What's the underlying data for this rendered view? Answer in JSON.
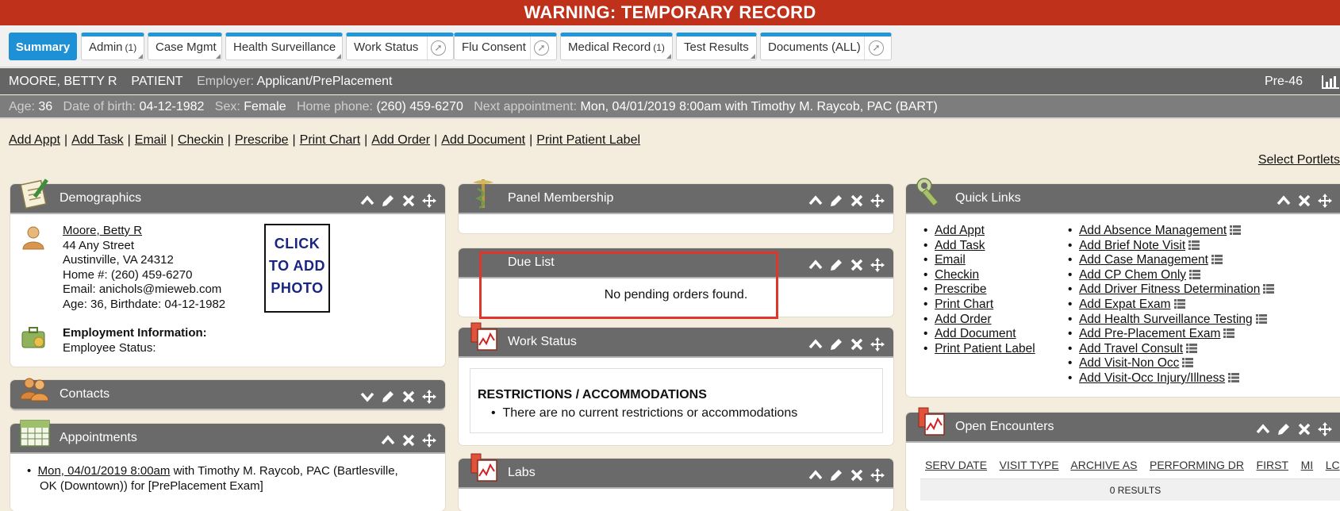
{
  "warning": "WARNING: TEMPORARY RECORD",
  "tabs": [
    {
      "label": "Summary",
      "count": "",
      "active": true
    },
    {
      "label": "Admin",
      "count": "(1)"
    },
    {
      "label": "Case Mgmt",
      "count": ""
    },
    {
      "label": "Health Surveillance",
      "count": ""
    },
    {
      "label": "Work Status",
      "count": ""
    },
    {
      "label": "Flu Consent",
      "count": ""
    },
    {
      "label": "Medical Record",
      "count": "(1)"
    },
    {
      "label": "Test Results",
      "count": ""
    },
    {
      "label": "Documents (ALL)",
      "count": ""
    }
  ],
  "patient": {
    "name": "MOORE, BETTY R",
    "type": "PATIENT",
    "employer_label": "Employer:",
    "employer": "Applicant/PrePlacement",
    "id": "Pre-46",
    "age_label": "Age:",
    "age": "36",
    "dob_label": "Date of birth:",
    "dob": "04-12-1982",
    "sex_label": "Sex:",
    "sex": "Female",
    "phone_label": "Home phone:",
    "phone": "(260) 459-6270",
    "next_label": "Next appointment:",
    "next_appt": "Mon, 04/01/2019 8:00am with Timothy M. Raycob, PAC (BART)"
  },
  "actions": [
    "Add Appt",
    "Add Task",
    "Email",
    "Checkin",
    "Prescribe",
    "Print Chart",
    "Add Order",
    "Add Document",
    "Print Patient Label"
  ],
  "actions_sep": "|",
  "select_portlets": "Select Portlets",
  "demographics": {
    "title": "Demographics",
    "name_link": "Moore, Betty R",
    "address1": "44 Any Street",
    "address2": "Austinville, VA 24312",
    "home": "Home #: (260) 459-6270",
    "email": "Email: anichols@mieweb.com",
    "age_line": "Age: 36, Birthdate: 04-12-1982",
    "photo": [
      "CLICK",
      "TO ADD",
      "PHOTO"
    ],
    "employment_heading": "Employment Information:",
    "employee_status": "Employee Status:"
  },
  "contacts": {
    "title": "Contacts"
  },
  "appointments": {
    "title": "Appointments",
    "bullet": "•",
    "appt_link": "Mon, 04/01/2019 8:00am",
    "appt_text1": " with Timothy M. Raycob, PAC (Bartlesville,",
    "appt_text2": "OK (Downtown)) for [PrePlacement Exam]"
  },
  "panel_membership": {
    "title": "Panel Membership"
  },
  "due_list": {
    "title": "Due List",
    "message": "No pending orders found."
  },
  "work_status": {
    "title": "Work Status",
    "heading": "RESTRICTIONS / ACCOMMODATIONS",
    "bullet": "•",
    "item": "There are no current restrictions or accommodations"
  },
  "labs": {
    "title": "Labs"
  },
  "quick_links": {
    "title": "Quick Links",
    "bullet": "•",
    "left": [
      "Add Appt",
      "Add Task",
      "Email",
      "Checkin",
      "Prescribe",
      "Print Chart",
      "Add Order",
      "Add Document",
      "Print Patient Label"
    ],
    "right": [
      "Add Absence Management",
      "Add Brief Note Visit",
      "Add Case Management",
      "Add CP Chem Only",
      "Add Driver Fitness Determination",
      "Add Expat Exam",
      "Add Health Surveillance Testing",
      "Add Pre-Placement Exam",
      "Add Travel Consult",
      "Add Visit-Non Occ",
      "Add Visit-Occ Injury/Illness"
    ]
  },
  "open_encounters": {
    "title": "Open Encounters",
    "columns": [
      "SERV DATE",
      "VISIT TYPE",
      "ARCHIVE AS",
      "PERFORMING DR",
      "FIRST",
      "MI",
      "LC"
    ],
    "results": "0 RESULTS"
  },
  "colors": {
    "warning": "#c0311c",
    "tab_accent": "#2196d8",
    "header": "#6a6a6a",
    "highlight": "#e0352b"
  }
}
